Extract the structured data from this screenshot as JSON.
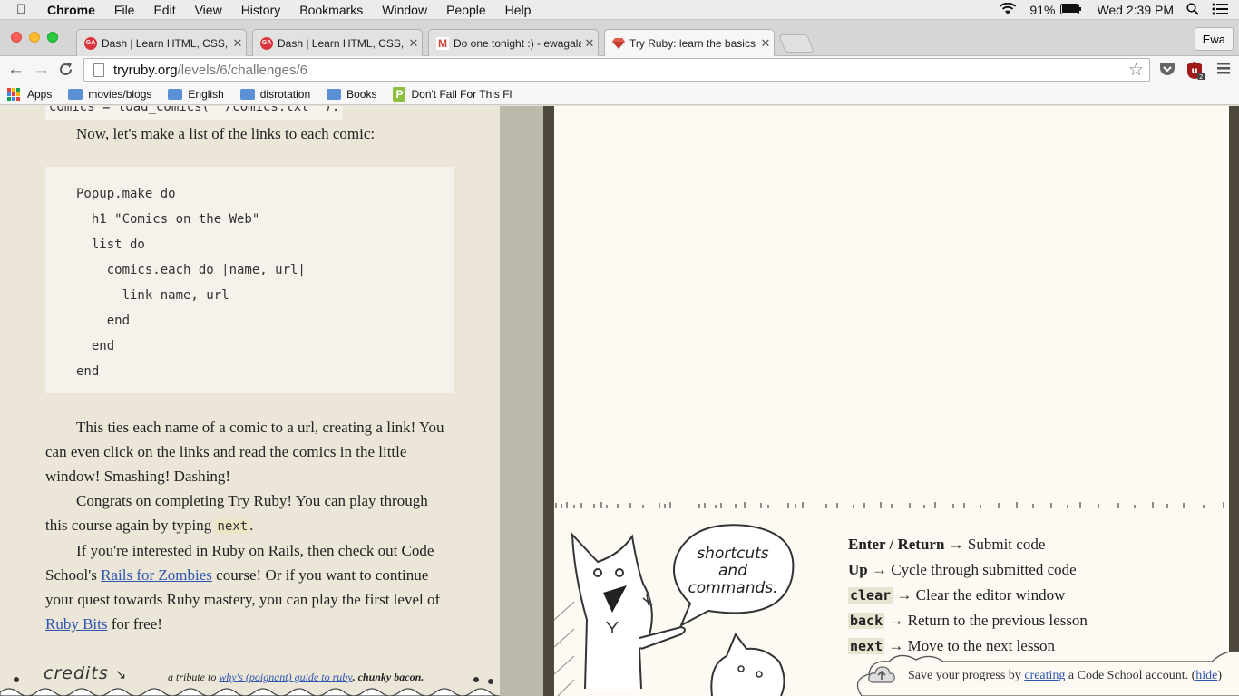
{
  "menubar": {
    "app": "Chrome",
    "items": [
      "File",
      "Edit",
      "View",
      "History",
      "Bookmarks",
      "Window",
      "People",
      "Help"
    ],
    "battery": "91%",
    "clock": "Wed 2:39 PM"
  },
  "tabs": [
    {
      "title": "Dash | Learn HTML, CSS, a",
      "favicon_color": "#d9363e"
    },
    {
      "title": "Dash | Learn HTML, CSS, a",
      "favicon_color": "#d9363e"
    },
    {
      "title": "Do one tonight :) - ewagala",
      "favicon_color": "#d44638"
    },
    {
      "title": "Try Ruby: learn the basics o",
      "favicon_color": "#c0392b"
    }
  ],
  "profile": "Ewa",
  "address": {
    "host": "tryruby.org",
    "path": "/levels/6/challenges/6"
  },
  "bookmarks": [
    "Apps",
    "movies/blogs",
    "English",
    "disrotation",
    "Books",
    "Don't Fall For This Fl"
  ],
  "lesson": {
    "prev_code": "comics = load_comics( '/comics.txt' ).",
    "intro": "Now, let's make a list of the links to each comic:",
    "code_lines": [
      "Popup.make do",
      "  h1 \"Comics on the Web\"",
      "  list do",
      "    comics.each do |name, url|",
      "      link name, url",
      "    end",
      "  end",
      "end"
    ],
    "p1": "This ties each name of a comic to a url, creating a link! You can even click on the links and read the comics in the little window! Smashing! Dashing!",
    "p2_before": "Congrats on completing Try Ruby! You can play through this course again by typing ",
    "p2_code": "next",
    "p2_after": ".",
    "p3_a": "If you're interested in Ruby on Rails, then check out Code School's ",
    "p3_link1": "Rails for Zombies",
    "p3_b": " course! Or if you want to continue your quest towards Ruby mastery, you can play the first level of ",
    "p3_link2": "Ruby Bits",
    "p3_c": " for free!"
  },
  "footer": {
    "credits": "credits",
    "tribute_prefix": "a tribute to ",
    "tribute_link": "why's (poignant) guide to ruby",
    "tribute_suffix": ". chunky bacon."
  },
  "bubble": {
    "line1": "shortcuts",
    "line2": "and",
    "line3": "commands."
  },
  "shortcuts": [
    {
      "key": "Enter / Return",
      "desc": "Submit code",
      "code": false
    },
    {
      "key": "Up",
      "desc": "Cycle through submitted code",
      "code": false
    },
    {
      "key": "clear",
      "desc": "Clear the editor window",
      "code": true
    },
    {
      "key": "back",
      "desc": "Return to the previous lesson",
      "code": true
    },
    {
      "key": "next",
      "desc": "Move to the next lesson",
      "code": true
    }
  ],
  "savebar": {
    "prefix": "Save your progress by ",
    "link": "creating",
    "middle": " a Code School account. (",
    "hide": "hide",
    "suffix": ")"
  }
}
